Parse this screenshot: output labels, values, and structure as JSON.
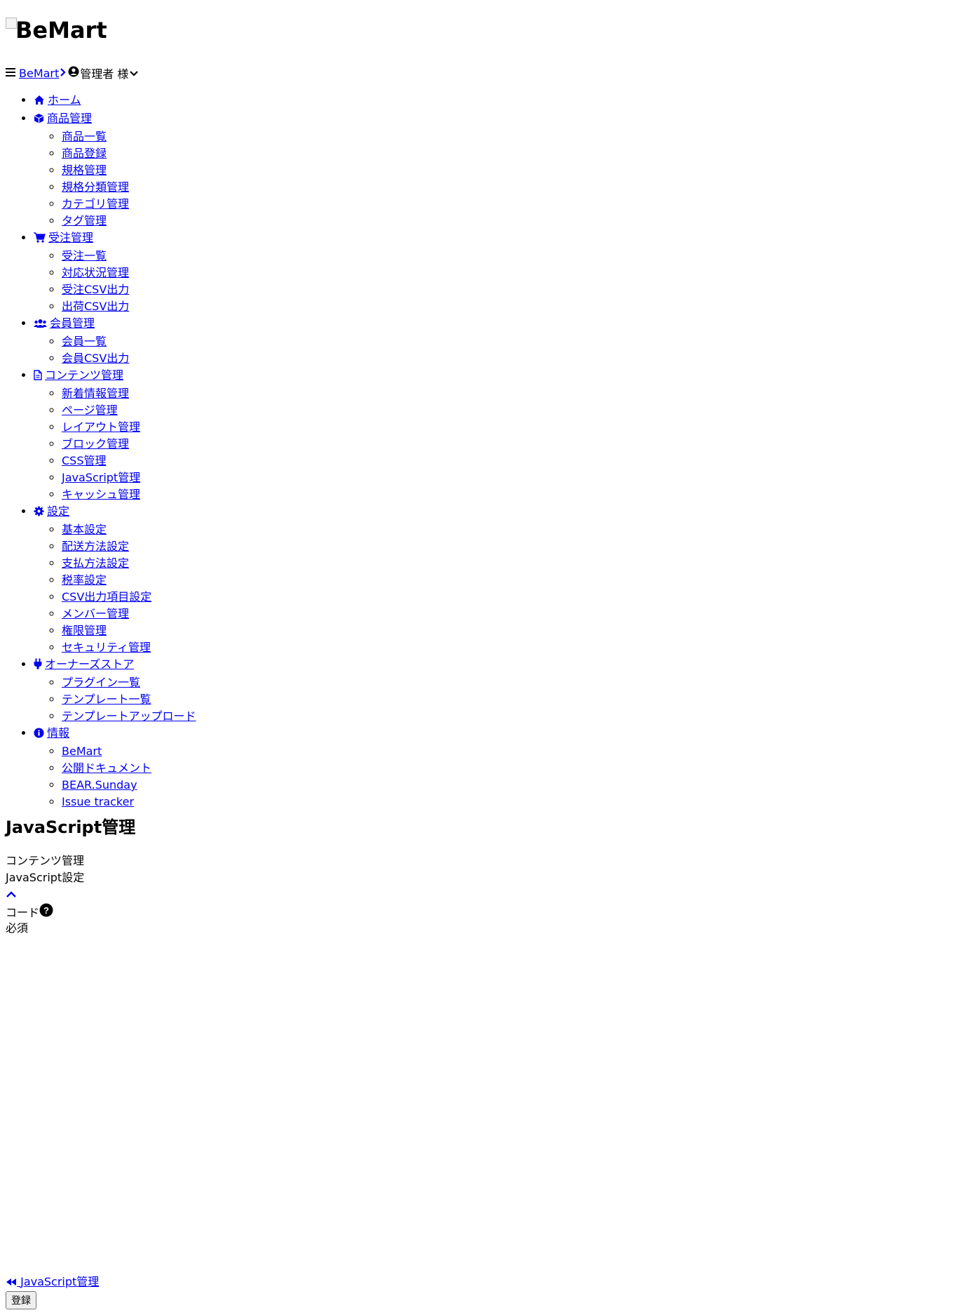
{
  "brand": {
    "logo_alt": "BeMart"
  },
  "topbar": {
    "menu_icon": "bars-icon",
    "site_link": "BeMart",
    "user_label": "管理者 様"
  },
  "nav": [
    {
      "label": "ホーム",
      "icon": "home-icon",
      "children": []
    },
    {
      "label": "商品管理",
      "icon": "cube-icon",
      "children": [
        "商品一覧",
        "商品登録",
        "規格管理",
        "規格分類管理",
        "カテゴリ管理",
        "タグ管理"
      ]
    },
    {
      "label": "受注管理",
      "icon": "cart-icon",
      "children": [
        "受注一覧",
        "対応状況管理",
        "受注CSV出力",
        "出荷CSV出力"
      ]
    },
    {
      "label": "会員管理",
      "icon": "users-icon",
      "children": [
        "会員一覧",
        "会員CSV出力"
      ]
    },
    {
      "label": "コンテンツ管理",
      "icon": "file-icon",
      "children": [
        "新着情報管理",
        "ページ管理",
        "レイアウト管理",
        "ブロック管理",
        "CSS管理",
        "JavaScript管理",
        "キャッシュ管理"
      ]
    },
    {
      "label": "設定",
      "icon": "gear-icon",
      "children": [
        "基本設定",
        "配送方法設定",
        "支払方法設定",
        "税率設定",
        "CSV出力項目設定",
        "メンバー管理",
        "権限管理",
        "セキュリティ管理"
      ]
    },
    {
      "label": "オーナーズストア",
      "icon": "plug-icon",
      "children": [
        "プラグイン一覧",
        "テンプレート一覧",
        "テンプレートアップロード"
      ]
    },
    {
      "label": "情報",
      "icon": "info-icon",
      "children": [
        "BeMart",
        "公開ドキュメント",
        "BEAR.Sunday",
        "Issue tracker"
      ]
    }
  ],
  "page": {
    "title": "JavaScript管理",
    "breadcrumb": "コンテンツ管理",
    "section_title": "JavaScript設定",
    "field_label": "コード",
    "required_label": "必須",
    "back_link": "JavaScript管理",
    "submit_label": "登録"
  }
}
